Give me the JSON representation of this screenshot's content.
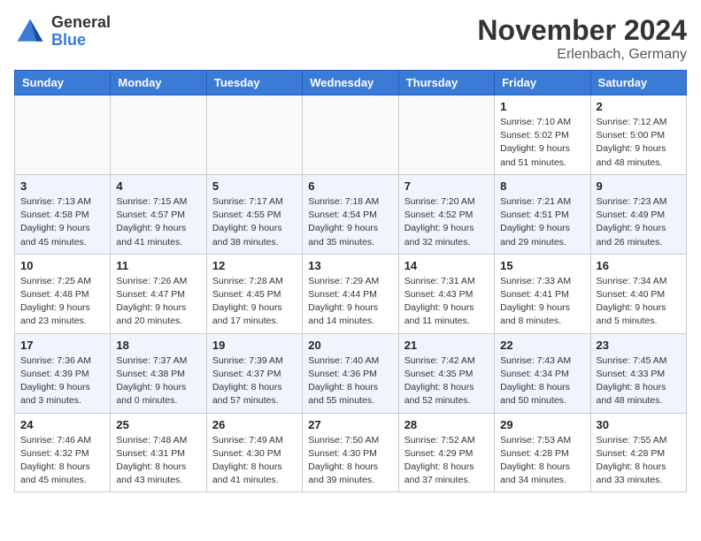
{
  "logo": {
    "general": "General",
    "blue": "Blue"
  },
  "title": "November 2024",
  "location": "Erlenbach, Germany",
  "days_of_week": [
    "Sunday",
    "Monday",
    "Tuesday",
    "Wednesday",
    "Thursday",
    "Friday",
    "Saturday"
  ],
  "weeks": [
    [
      {
        "day": "",
        "info": ""
      },
      {
        "day": "",
        "info": ""
      },
      {
        "day": "",
        "info": ""
      },
      {
        "day": "",
        "info": ""
      },
      {
        "day": "",
        "info": ""
      },
      {
        "day": "1",
        "info": "Sunrise: 7:10 AM\nSunset: 5:02 PM\nDaylight: 9 hours\nand 51 minutes."
      },
      {
        "day": "2",
        "info": "Sunrise: 7:12 AM\nSunset: 5:00 PM\nDaylight: 9 hours\nand 48 minutes."
      }
    ],
    [
      {
        "day": "3",
        "info": "Sunrise: 7:13 AM\nSunset: 4:58 PM\nDaylight: 9 hours\nand 45 minutes."
      },
      {
        "day": "4",
        "info": "Sunrise: 7:15 AM\nSunset: 4:57 PM\nDaylight: 9 hours\nand 41 minutes."
      },
      {
        "day": "5",
        "info": "Sunrise: 7:17 AM\nSunset: 4:55 PM\nDaylight: 9 hours\nand 38 minutes."
      },
      {
        "day": "6",
        "info": "Sunrise: 7:18 AM\nSunset: 4:54 PM\nDaylight: 9 hours\nand 35 minutes."
      },
      {
        "day": "7",
        "info": "Sunrise: 7:20 AM\nSunset: 4:52 PM\nDaylight: 9 hours\nand 32 minutes."
      },
      {
        "day": "8",
        "info": "Sunrise: 7:21 AM\nSunset: 4:51 PM\nDaylight: 9 hours\nand 29 minutes."
      },
      {
        "day": "9",
        "info": "Sunrise: 7:23 AM\nSunset: 4:49 PM\nDaylight: 9 hours\nand 26 minutes."
      }
    ],
    [
      {
        "day": "10",
        "info": "Sunrise: 7:25 AM\nSunset: 4:48 PM\nDaylight: 9 hours\nand 23 minutes."
      },
      {
        "day": "11",
        "info": "Sunrise: 7:26 AM\nSunset: 4:47 PM\nDaylight: 9 hours\nand 20 minutes."
      },
      {
        "day": "12",
        "info": "Sunrise: 7:28 AM\nSunset: 4:45 PM\nDaylight: 9 hours\nand 17 minutes."
      },
      {
        "day": "13",
        "info": "Sunrise: 7:29 AM\nSunset: 4:44 PM\nDaylight: 9 hours\nand 14 minutes."
      },
      {
        "day": "14",
        "info": "Sunrise: 7:31 AM\nSunset: 4:43 PM\nDaylight: 9 hours\nand 11 minutes."
      },
      {
        "day": "15",
        "info": "Sunrise: 7:33 AM\nSunset: 4:41 PM\nDaylight: 9 hours\nand 8 minutes."
      },
      {
        "day": "16",
        "info": "Sunrise: 7:34 AM\nSunset: 4:40 PM\nDaylight: 9 hours\nand 5 minutes."
      }
    ],
    [
      {
        "day": "17",
        "info": "Sunrise: 7:36 AM\nSunset: 4:39 PM\nDaylight: 9 hours\nand 3 minutes."
      },
      {
        "day": "18",
        "info": "Sunrise: 7:37 AM\nSunset: 4:38 PM\nDaylight: 9 hours\nand 0 minutes."
      },
      {
        "day": "19",
        "info": "Sunrise: 7:39 AM\nSunset: 4:37 PM\nDaylight: 8 hours\nand 57 minutes."
      },
      {
        "day": "20",
        "info": "Sunrise: 7:40 AM\nSunset: 4:36 PM\nDaylight: 8 hours\nand 55 minutes."
      },
      {
        "day": "21",
        "info": "Sunrise: 7:42 AM\nSunset: 4:35 PM\nDaylight: 8 hours\nand 52 minutes."
      },
      {
        "day": "22",
        "info": "Sunrise: 7:43 AM\nSunset: 4:34 PM\nDaylight: 8 hours\nand 50 minutes."
      },
      {
        "day": "23",
        "info": "Sunrise: 7:45 AM\nSunset: 4:33 PM\nDaylight: 8 hours\nand 48 minutes."
      }
    ],
    [
      {
        "day": "24",
        "info": "Sunrise: 7:46 AM\nSunset: 4:32 PM\nDaylight: 8 hours\nand 45 minutes."
      },
      {
        "day": "25",
        "info": "Sunrise: 7:48 AM\nSunset: 4:31 PM\nDaylight: 8 hours\nand 43 minutes."
      },
      {
        "day": "26",
        "info": "Sunrise: 7:49 AM\nSunset: 4:30 PM\nDaylight: 8 hours\nand 41 minutes."
      },
      {
        "day": "27",
        "info": "Sunrise: 7:50 AM\nSunset: 4:30 PM\nDaylight: 8 hours\nand 39 minutes."
      },
      {
        "day": "28",
        "info": "Sunrise: 7:52 AM\nSunset: 4:29 PM\nDaylight: 8 hours\nand 37 minutes."
      },
      {
        "day": "29",
        "info": "Sunrise: 7:53 AM\nSunset: 4:28 PM\nDaylight: 8 hours\nand 34 minutes."
      },
      {
        "day": "30",
        "info": "Sunrise: 7:55 AM\nSunset: 4:28 PM\nDaylight: 8 hours\nand 33 minutes."
      }
    ]
  ]
}
